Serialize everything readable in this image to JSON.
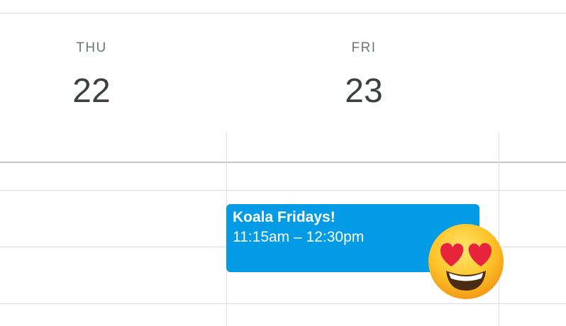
{
  "days": [
    {
      "dow": "THU",
      "date": "22"
    },
    {
      "dow": "FRI",
      "date": "23"
    }
  ],
  "event": {
    "title": "Koala Fridays!",
    "time": "11:15am – 12:30pm",
    "color": "#039be5"
  },
  "sticker": {
    "icon": "heart-eyes-emoji-icon"
  }
}
